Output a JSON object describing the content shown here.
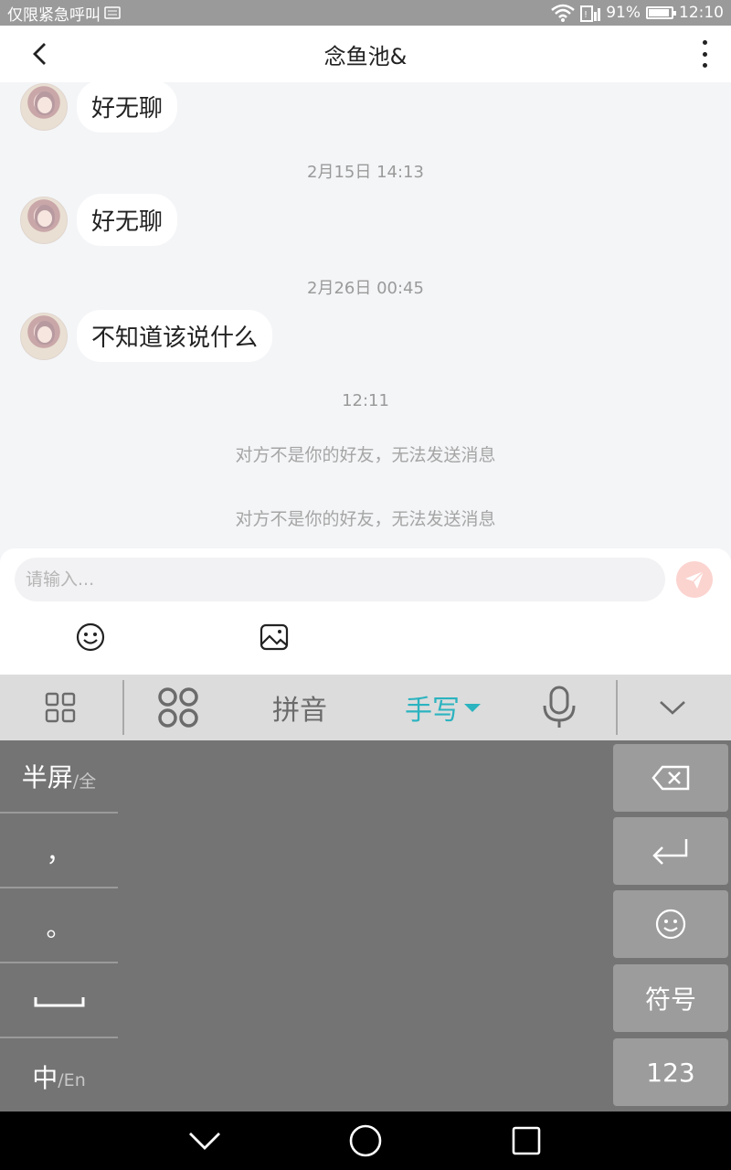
{
  "status_bar": {
    "carrier_text": "仅限紧急呼叫",
    "battery_percent": "91%",
    "battery_level": 0.91,
    "time": "12:10",
    "icons": [
      "sim-card-icon",
      "wifi-icon",
      "signal-icon",
      "battery-icon"
    ]
  },
  "header": {
    "title": "念鱼池&",
    "back_icon": "back-arrow-icon",
    "more_icon": "more-vertical-icon"
  },
  "chat": {
    "messages": [
      {
        "text": "好无聊"
      },
      {
        "text": "好无聊"
      },
      {
        "text": "不知道该说什么"
      }
    ],
    "timestamps": [
      "2月15日 14:13",
      "2月26日 00:45",
      "12:11"
    ],
    "system_notices": [
      "对方不是你的好友，无法发送消息",
      "对方不是你的好友，无法发送消息"
    ]
  },
  "input": {
    "placeholder": "请输入...",
    "value": "",
    "send_icon": "send-icon",
    "emoji_icon": "emoji-icon",
    "image_icon": "image-icon"
  },
  "keyboard_toolbar": {
    "grid_icon": "grid-icon",
    "clover_icon": "clover-icon",
    "pinyin_label": "拼音",
    "handwrite_label": "手写",
    "handwrite_active": true,
    "accent_color": "#2bb3c0",
    "mic_icon": "microphone-icon",
    "collapse_icon": "chevron-down-icon"
  },
  "keyboard": {
    "half_screen_label": "半屏",
    "full_label": "/全",
    "comma": "，",
    "period": "。",
    "space_icon": "space-icon",
    "lang_main": "中",
    "lang_alt": "/En",
    "delete_icon": "backspace-icon",
    "enter_icon": "enter-icon",
    "emoji_icon": "emoji-icon",
    "symbols_label": "符号",
    "numbers_label": "123"
  },
  "nav_bar": {
    "back_icon": "nav-back-icon",
    "home_icon": "nav-home-icon",
    "recents_icon": "nav-recents-icon"
  }
}
